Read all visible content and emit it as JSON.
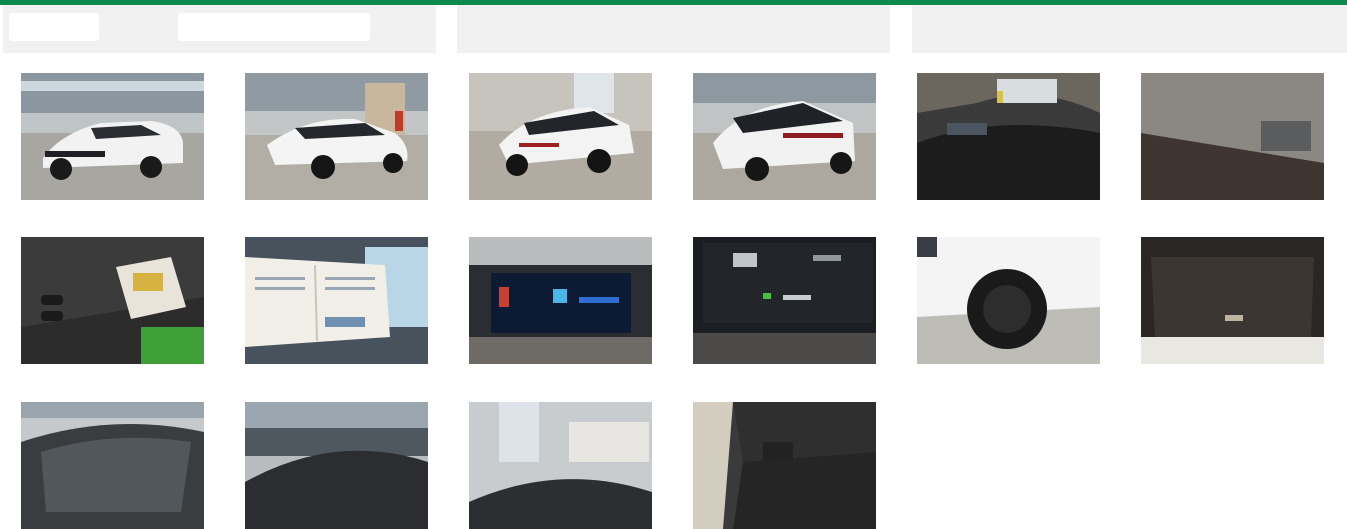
{
  "colors": {
    "accent": "#0e8a4f",
    "panel_bg": "#f1f1f1",
    "page_bg": "#ffffff"
  },
  "header": {
    "buttons": [
      {
        "name": "header-button-left",
        "label": ""
      },
      {
        "name": "header-button-right",
        "label": ""
      }
    ]
  },
  "gallery": {
    "photos": [
      {
        "subject": "car-exterior-front-left"
      },
      {
        "subject": "car-exterior-front-right"
      },
      {
        "subject": "car-exterior-rear-left"
      },
      {
        "subject": "car-exterior-rear-right"
      },
      {
        "subject": "car-interior-dashboard"
      },
      {
        "subject": "car-headliner-sunroof"
      },
      {
        "subject": "car-keys-and-manual"
      },
      {
        "subject": "car-service-book"
      },
      {
        "subject": "car-instrument-cluster"
      },
      {
        "subject": "car-odometer-display"
      },
      {
        "subject": "car-front-wheel"
      },
      {
        "subject": "car-trunk-cargo"
      },
      {
        "subject": "car-windshield"
      },
      {
        "subject": "car-roof-showroom"
      },
      {
        "subject": "car-roof-panorama"
      },
      {
        "subject": "car-rear-seat-cargo"
      }
    ]
  }
}
